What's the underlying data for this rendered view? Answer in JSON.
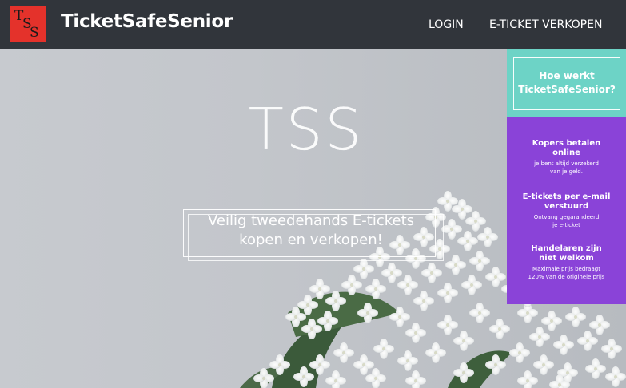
{
  "header": {
    "logo": {
      "letter1": "T",
      "letter2": "S",
      "letter3": "S",
      "color": "#e4322b"
    },
    "brand": "TicketSafeSenior",
    "nav": {
      "login": "LOGIN",
      "sell": "E-TICKET VERKOPEN"
    }
  },
  "hero": {
    "title": "TSS",
    "tagline_line1": "Veilig tweedehands E-tickets",
    "tagline_line2": "kopen en verkopen!"
  },
  "sidebar": {
    "how_line1": "Hoe werkt",
    "how_line2": "TicketSafeSenior?",
    "how_color": "#6dd3c6",
    "features_color": "#8a43d8",
    "features": [
      {
        "title1": "Kopers betalen",
        "title2": "online",
        "desc1": "je bent altijd verzekerd",
        "desc2": "van je geld."
      },
      {
        "title1": "E-tickets per e-mail",
        "title2": "verstuurd",
        "desc1": "Ontvang gegarandeerd",
        "desc2": "je e-ticket"
      },
      {
        "title1": "Handelaren zijn",
        "title2": "niet welkom",
        "desc1": "Maximale prijs bedraagt",
        "desc2": "120% van de originele prijs"
      }
    ]
  }
}
